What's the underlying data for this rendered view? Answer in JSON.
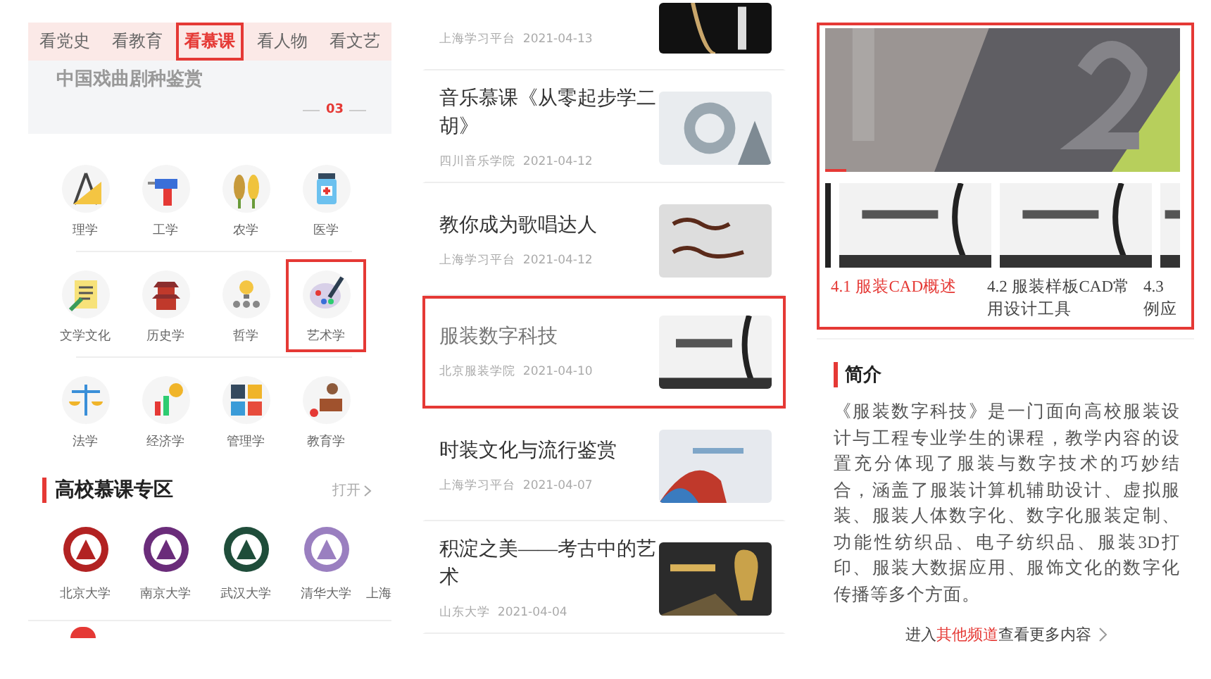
{
  "left": {
    "tabs": [
      {
        "label": "看党史",
        "selected": false,
        "highlighted": false
      },
      {
        "label": "看教育",
        "selected": false,
        "highlighted": false
      },
      {
        "label": "看慕课",
        "selected": true,
        "highlighted": true
      },
      {
        "label": "看人物",
        "selected": false,
        "highlighted": false
      },
      {
        "label": "看文艺",
        "selected": false,
        "highlighted": false
      }
    ],
    "banner": {
      "title": "中国戏曲剧种鉴赏",
      "page": "03"
    },
    "subjects": [
      {
        "label": "理学",
        "highlighted": false
      },
      {
        "label": "工学",
        "highlighted": false
      },
      {
        "label": "农学",
        "highlighted": false
      },
      {
        "label": "医学",
        "highlighted": false
      },
      {
        "label": "文学文化",
        "highlighted": false
      },
      {
        "label": "历史学",
        "highlighted": false
      },
      {
        "label": "哲学",
        "highlighted": false
      },
      {
        "label": "艺术学",
        "highlighted": true
      },
      {
        "label": "法学",
        "highlighted": false
      },
      {
        "label": "经济学",
        "highlighted": false
      },
      {
        "label": "管理学",
        "highlighted": false
      },
      {
        "label": "教育学",
        "highlighted": false
      }
    ],
    "section": {
      "title": "高校慕课专区",
      "action": "打开"
    },
    "universities": [
      {
        "name": "北京大学",
        "color": "#b22222"
      },
      {
        "name": "南京大学",
        "color": "#6a2c7a"
      },
      {
        "name": "武汉大学",
        "color": "#1f4d3a"
      },
      {
        "name": "清华大学",
        "color": "#9a7fc0"
      },
      {
        "name": "上海"
      }
    ]
  },
  "middle": {
    "items": [
      {
        "source": "上海学习平台",
        "date": "2021-04-13",
        "highlighted": false
      },
      {
        "title": "音乐慕课《从零起步学二胡》",
        "source": "四川音乐学院",
        "date": "2021-04-12",
        "highlighted": false
      },
      {
        "title": "教你成为歌唱达人",
        "source": "上海学习平台",
        "date": "2021-04-12",
        "highlighted": false
      },
      {
        "title": "服装数字科技",
        "source": "北京服装学院",
        "date": "2021-04-10",
        "highlighted": true
      },
      {
        "title": "时装文化与流行鉴赏",
        "source": "上海学习平台",
        "date": "2021-04-07",
        "highlighted": false
      },
      {
        "title": "积淀之美——考古中的艺术",
        "source": "山东大学",
        "date": "2021-04-04",
        "highlighted": false
      }
    ]
  },
  "right": {
    "highlighted": true,
    "video": {
      "level": 0.06
    },
    "chapters": [
      {
        "label": "4.1 服装CAD概述",
        "selected": true
      },
      {
        "label": "4.2 服装样板CAD常用设计工具",
        "selected": false
      },
      {
        "label": "4.3 例应",
        "selected": false
      }
    ],
    "intro": {
      "heading": "简介",
      "text": "《服装数字科技》是一门面向高校服装设计与工程专业学生的课程，教学内容的设置充分体现了服装与数字技术的巧妙结合，涵盖了服装计算机辅助设计、虚拟服装、服装人体数字化、数字化服装定制、功能性纺织品、电子纺织品、服装3D打印、服装大数据应用、服饰文化的数字化传播等多个方面。",
      "link_prefix": "进入",
      "link": "其他频道",
      "link_suffix": "查看更多内容"
    }
  }
}
